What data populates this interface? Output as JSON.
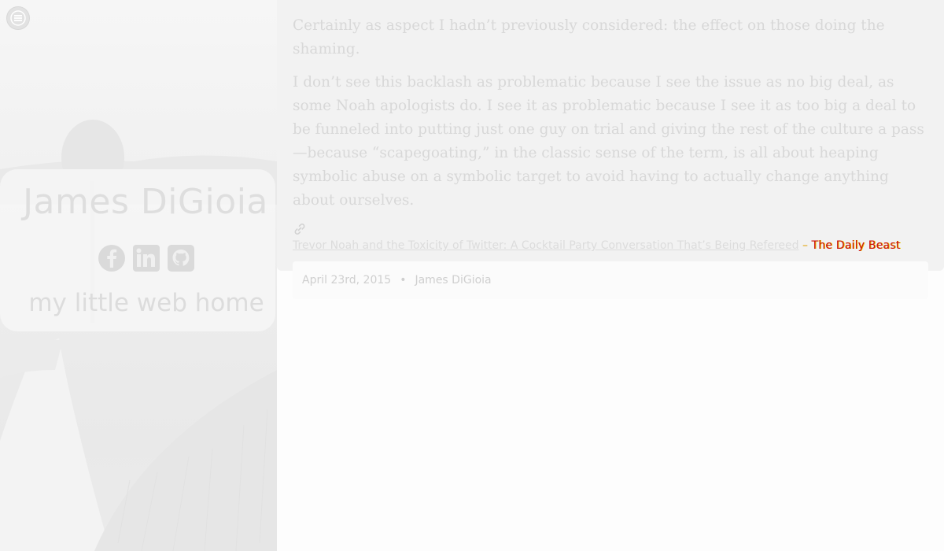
{
  "sidebar": {
    "menu_icon": "hamburger-menu-icon",
    "name": "James DiGioia",
    "tagline": "my little web home",
    "socials": [
      {
        "label": "Facebook",
        "icon": "facebook-icon"
      },
      {
        "label": "LinkedIn",
        "icon": "linkedin-icon"
      },
      {
        "label": "GitHub",
        "icon": "github-icon"
      }
    ]
  },
  "post": {
    "paragraphs": [
      "Certainly as aspect I hadn’t previously considered: the effect on those doing the shaming.",
      "I don’t see this backlash as problematic because I see the issue as no big deal, as some Noah apologists do. I see it as problematic because I see it as too big a deal to be funneled into putting just one guy on trial and giving the rest of the culture a pass—because “scapegoating,” in the classic sense of the term, is all about heaping symbolic abuse on a symbolic target to avoid having to actually change anything about ourselves."
    ],
    "link_icon": "link-icon",
    "source_title": "Trevor Noah and the Toxicity of Twitter: A Cocktail Party Conversation That’s Being Refereed",
    "source_separator": " – ",
    "source_name": "The Daily Beast",
    "date": "April 23rd, 2015",
    "meta_separator": "•",
    "author": "James DiGioia"
  },
  "colors": {
    "sidebar_bg": "#eeeeee",
    "card_bg": "#f2f2f2",
    "meta_bg": "#fbfbfb",
    "text_faded": "#d8d8d8",
    "accent_red": "#cc1010",
    "accent_yellow": "#e8c000"
  }
}
